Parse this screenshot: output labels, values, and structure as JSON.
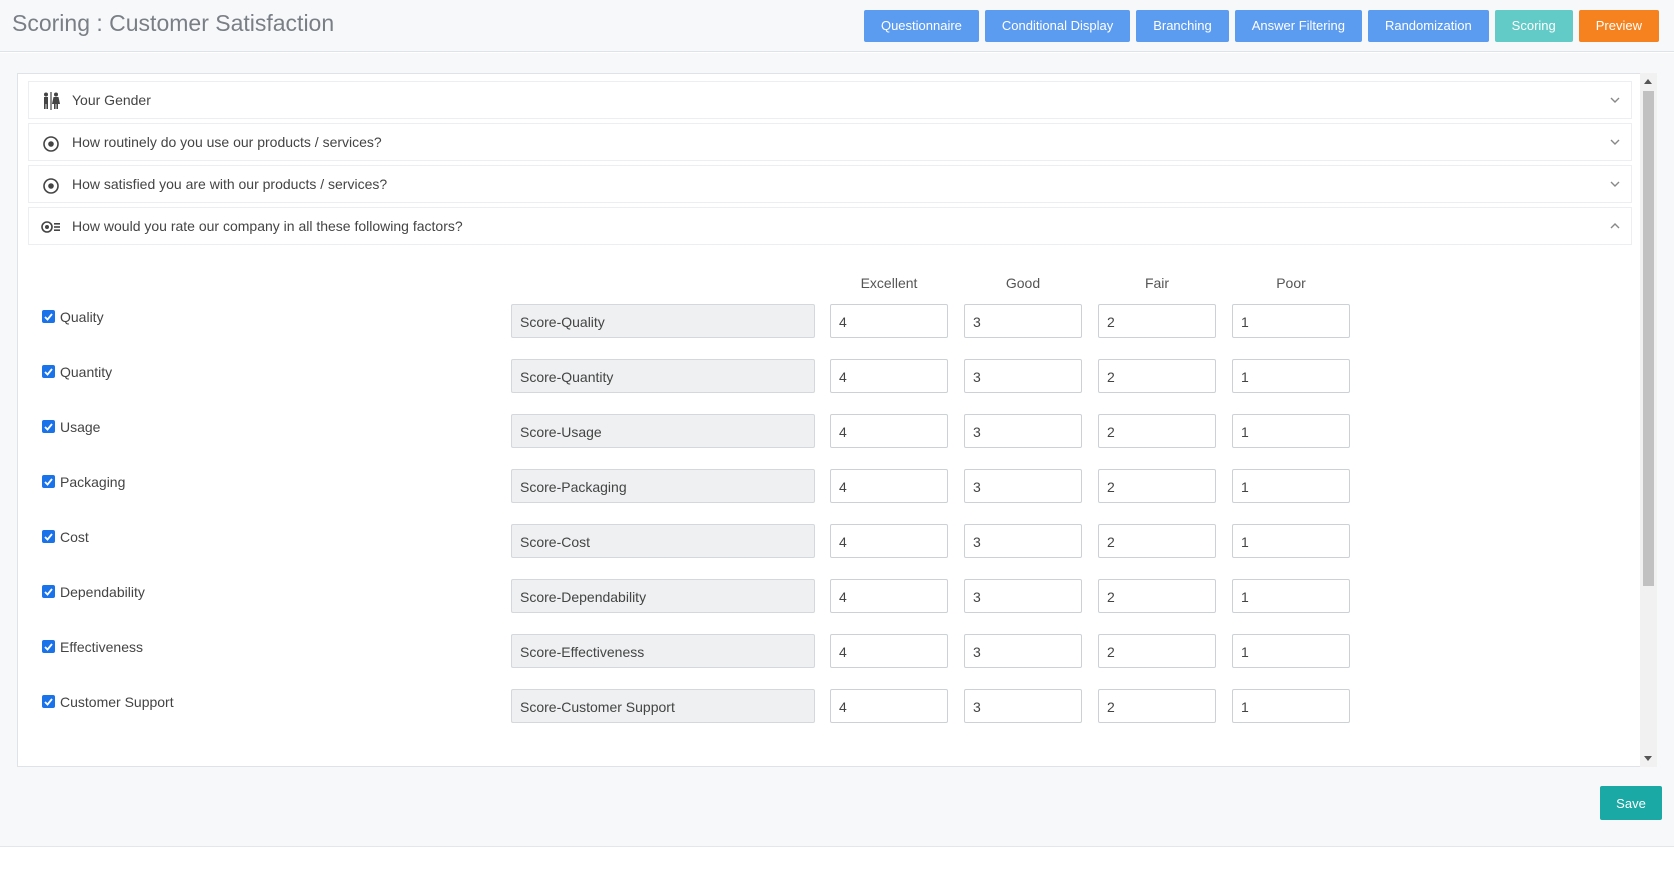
{
  "header": {
    "title": "Scoring : Customer Satisfaction",
    "nav": [
      {
        "label": "Questionnaire"
      },
      {
        "label": "Conditional Display"
      },
      {
        "label": "Branching"
      },
      {
        "label": "Answer Filtering"
      },
      {
        "label": "Randomization"
      },
      {
        "label": "Scoring"
      },
      {
        "label": "Preview"
      }
    ]
  },
  "questions": [
    {
      "label": "Your Gender",
      "icon": "gender-icon",
      "expanded": false
    },
    {
      "label": "How routinely do you use our products / services?",
      "icon": "radio-icon",
      "expanded": false
    },
    {
      "label": "How satisfied you are with our products / services?",
      "icon": "radio-icon",
      "expanded": false
    },
    {
      "label": "How would you rate our company in all these following factors?",
      "icon": "matrix-icon",
      "expanded": true
    }
  ],
  "scoring": {
    "columns": [
      "Excellent",
      "Good",
      "Fair",
      "Poor"
    ],
    "rows": [
      {
        "label": "Quality",
        "checked": true,
        "score_name": "Score-Quality",
        "values": [
          "4",
          "3",
          "2",
          "1"
        ]
      },
      {
        "label": "Quantity",
        "checked": true,
        "score_name": "Score-Quantity",
        "values": [
          "4",
          "3",
          "2",
          "1"
        ]
      },
      {
        "label": "Usage",
        "checked": true,
        "score_name": "Score-Usage",
        "values": [
          "4",
          "3",
          "2",
          "1"
        ]
      },
      {
        "label": "Packaging",
        "checked": true,
        "score_name": "Score-Packaging",
        "values": [
          "4",
          "3",
          "2",
          "1"
        ]
      },
      {
        "label": "Cost",
        "checked": true,
        "score_name": "Score-Cost",
        "values": [
          "4",
          "3",
          "2",
          "1"
        ]
      },
      {
        "label": "Dependability",
        "checked": true,
        "score_name": "Score-Dependability",
        "values": [
          "4",
          "3",
          "2",
          "1"
        ]
      },
      {
        "label": "Effectiveness",
        "checked": true,
        "score_name": "Score-Effectiveness",
        "values": [
          "4",
          "3",
          "2",
          "1"
        ]
      },
      {
        "label": "Customer Support",
        "checked": true,
        "score_name": "Score-Customer Support",
        "values": [
          "4",
          "3",
          "2",
          "1"
        ]
      }
    ]
  },
  "footer": {
    "save_label": "Save"
  },
  "colors": {
    "nav_blue": "#5b9bf0",
    "scoring_teal": "#62cbc8",
    "preview_orange": "#f5821f",
    "save_teal": "#1aa9a4"
  }
}
